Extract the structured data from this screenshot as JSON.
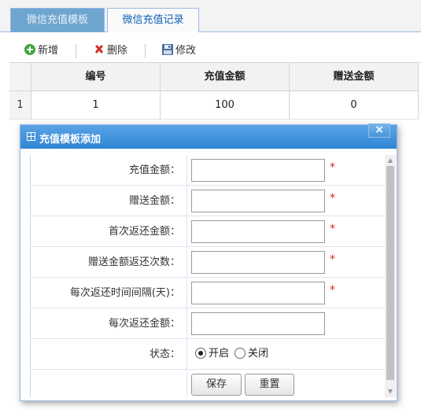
{
  "tabs": [
    {
      "label": "微信充值模板",
      "active": true
    },
    {
      "label": "微信充值记录",
      "active": false
    }
  ],
  "toolbar": {
    "add_label": "新增",
    "delete_label": "删除",
    "edit_label": "修改"
  },
  "grid": {
    "columns": [
      "编号",
      "充值金额",
      "赠送金额"
    ],
    "rows": [
      {
        "row_number": "1",
        "cells": [
          "1",
          "100",
          "0"
        ]
      }
    ]
  },
  "dialog": {
    "title": "充值模板添加",
    "close_glyph": "×",
    "fields": [
      {
        "label": "充值金额：",
        "value": "",
        "required": true
      },
      {
        "label": "赠送金额：",
        "value": "",
        "required": true
      },
      {
        "label": "首次返还金额：",
        "value": "",
        "required": true
      },
      {
        "label": "赠送金额返还次数：",
        "value": "",
        "required": true
      },
      {
        "label": "每次返还时间间隔(天)：",
        "value": "",
        "required": true
      },
      {
        "label": "每次返还金额：",
        "value": "",
        "required": false
      }
    ],
    "required_mark": "*",
    "status": {
      "label": "状态：",
      "options": [
        {
          "label": "开启",
          "checked": true
        },
        {
          "label": "关闭",
          "checked": false
        }
      ]
    },
    "buttons": {
      "save_label": "保存",
      "reset_label": "重置"
    }
  },
  "colors": {
    "accent": "#2f86d4",
    "tab_active_bg": "#6fa6d0",
    "tab_inactive_text": "#0e62b6",
    "required": "#e02020"
  },
  "icons": {
    "add": "plus-circle-icon",
    "delete": "red-x-icon",
    "edit": "floppy-disk-icon"
  }
}
